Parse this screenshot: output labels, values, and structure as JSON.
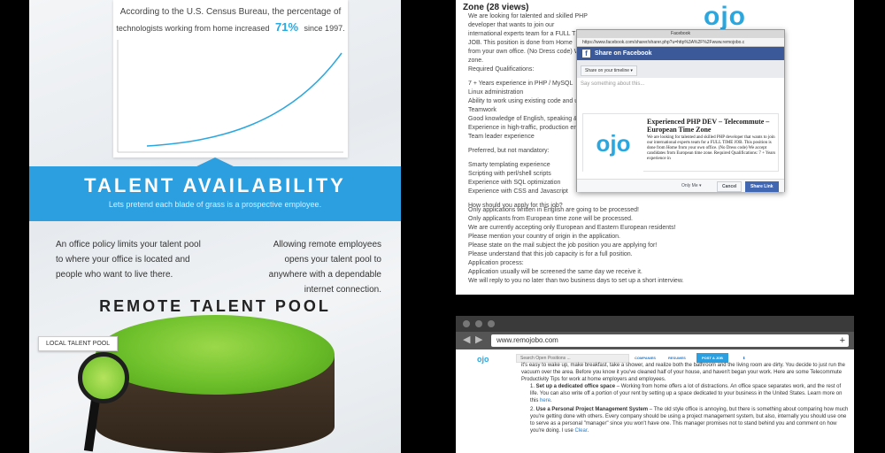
{
  "infographic": {
    "census_line1": "According to the U.S. Census Bureau, the percentage of",
    "census_line2a": "technologists working from home increased",
    "census_pct": "71%",
    "census_line2b": "since 1997.",
    "banner_title": "TALENT AVAILABILITY",
    "banner_sub": "Lets pretend each blade of grass is a prospective employee.",
    "policy_left": "An office policy limits your talent pool to where your office is located and people who want to live there.",
    "policy_right": "Allowing remote employees opens your talent pool to anywhere with a dependable internet connection.",
    "pool_title": "REMOTE TALENT POOL",
    "local_label": "LOCAL TALENT POOL",
    "colors": {
      "accent": "#2b9fe0",
      "grass": "#6cbf2a"
    }
  },
  "job_page": {
    "title": "Zone (28 views)",
    "logo": "ojo",
    "lines_top": [
      "We are looking for talented and skilled PHP developer that wants to join our",
      "international experts team for a FULL TIME JOB. This position is done from Home",
      "from your own office. (No Dress code) We",
      "zone.",
      "Required Qualifications:",
      "",
      "7 + Years experience in PHP / MySQL",
      "Linux administration",
      "Ability to work using existing code and up",
      "Teamwork",
      "Good knowledge of English, speaking &",
      "Experience in high-traffic, production envi",
      "Team leader experience",
      "",
      "Preferred, but not mandatory:",
      "",
      "Smarty templating experience",
      "Scripting with perl/shell scripts",
      "Experience with SQL optimization",
      "Experience with CSS and Javascript",
      "",
      "How should you apply for this job?"
    ],
    "lines_bottom": [
      "Only applications written in English are going to be processed!",
      "Only applicants from European time zone will be processed.",
      "We are currently accepting only European and Eastern European residents!",
      "Please mention your country of origin in the application.",
      "Please state on the mail subject the job position you are applying for!",
      "Please understand that this job capacity is for a full position.",
      "",
      "Application process:",
      "",
      "Application usually will be screened the same day we receive it.",
      "We will reply to you no later than two business days to set up a short interview."
    ]
  },
  "facebook_dialog": {
    "window_title": "Facebook",
    "url": "https://www.facebook.com/sharer/sharer.php?u=http%3A%2F%2Fwww.remojobo.c",
    "header": "Share on Facebook",
    "timeline_select": "Share on your timeline ▾",
    "placeholder": "Say something about this...",
    "preview_title": "Experienced PHP DEV – Telecommute – European Time Zone",
    "preview_desc": "We are looking for talented and skilled PHP developer that wants to join our international experts team for a FULL TIME JOB. This position is done from Home from your own office. (No Dress code) We accept candidates from European time zone. Required Qualifications: 7 + Years experience in",
    "thumb_logo": "ojo",
    "privacy": "Only Me ▾",
    "cancel": "Cancel",
    "share": "Share Link",
    "colors": {
      "fb_blue": "#3b5998",
      "share_btn": "#4267b2"
    }
  },
  "browser": {
    "url": "www.remojobo.com",
    "new_tab": "+",
    "back": "◀",
    "forward": "▶",
    "site": {
      "logo": "ojo",
      "search_placeholder": "Search Open Positions ...",
      "nav": [
        "COMPANIES",
        "RESUMES",
        "POST A JOB",
        "⬇"
      ],
      "intro": "it's easy to wake up, make breakfast, take a shower, and realize both the bathroom and the living room are dirty. You decide to just run the vacuum over the area. Before you know it you've cleaned half of your house, and haven't began your work. Here are some Telecommute Productivity Tips for work at home employers and employees.",
      "items": [
        {
          "num": "1.",
          "bold": "Set up a dedicated office space",
          "text": " – Working from home offers a lot of distractions. An office space separates work, and the rest of life. You can also write off a portion of your rent by setting up a space dedicated to your business in the United States. Learn more on this ",
          "link": "here",
          "tail": "."
        },
        {
          "num": "2.",
          "bold": "Use a Personal Project Management System",
          "text": " – The old style office is annoying, but there is something about comparing how much you're getting done with others. Every company should be using a project management system, but also, internally you should use one to serve as a personal \"manager\" since you won't have one. This manager promises not to stand behind you and comment on how you're doing. I use ",
          "link": "Clear",
          "tail": "."
        }
      ]
    }
  }
}
